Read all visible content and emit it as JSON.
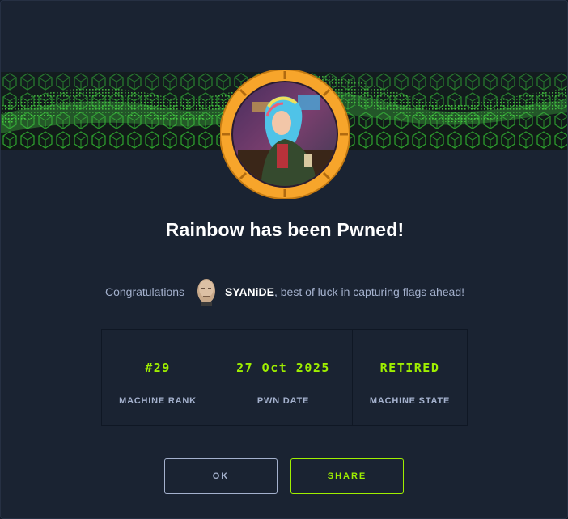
{
  "modal": {
    "title": "Rainbow has been Pwned!",
    "congrats_prefix": "Congratulations",
    "username": "SYANiDE",
    "congrats_suffix": ", best of luck in capturing flags ahead!"
  },
  "stats": [
    {
      "value": "#29",
      "label": "MACHINE RANK"
    },
    {
      "value": "27 Oct 2025",
      "label": "PWN DATE"
    },
    {
      "value": "RETIRED",
      "label": "MACHINE STATE"
    }
  ],
  "buttons": {
    "ok_label": "OK",
    "share_label": "SHARE"
  },
  "colors": {
    "accent": "#9fef00",
    "background": "#1a2332",
    "ring": "#f7a52b",
    "muted_text": "#a4b1cd"
  }
}
